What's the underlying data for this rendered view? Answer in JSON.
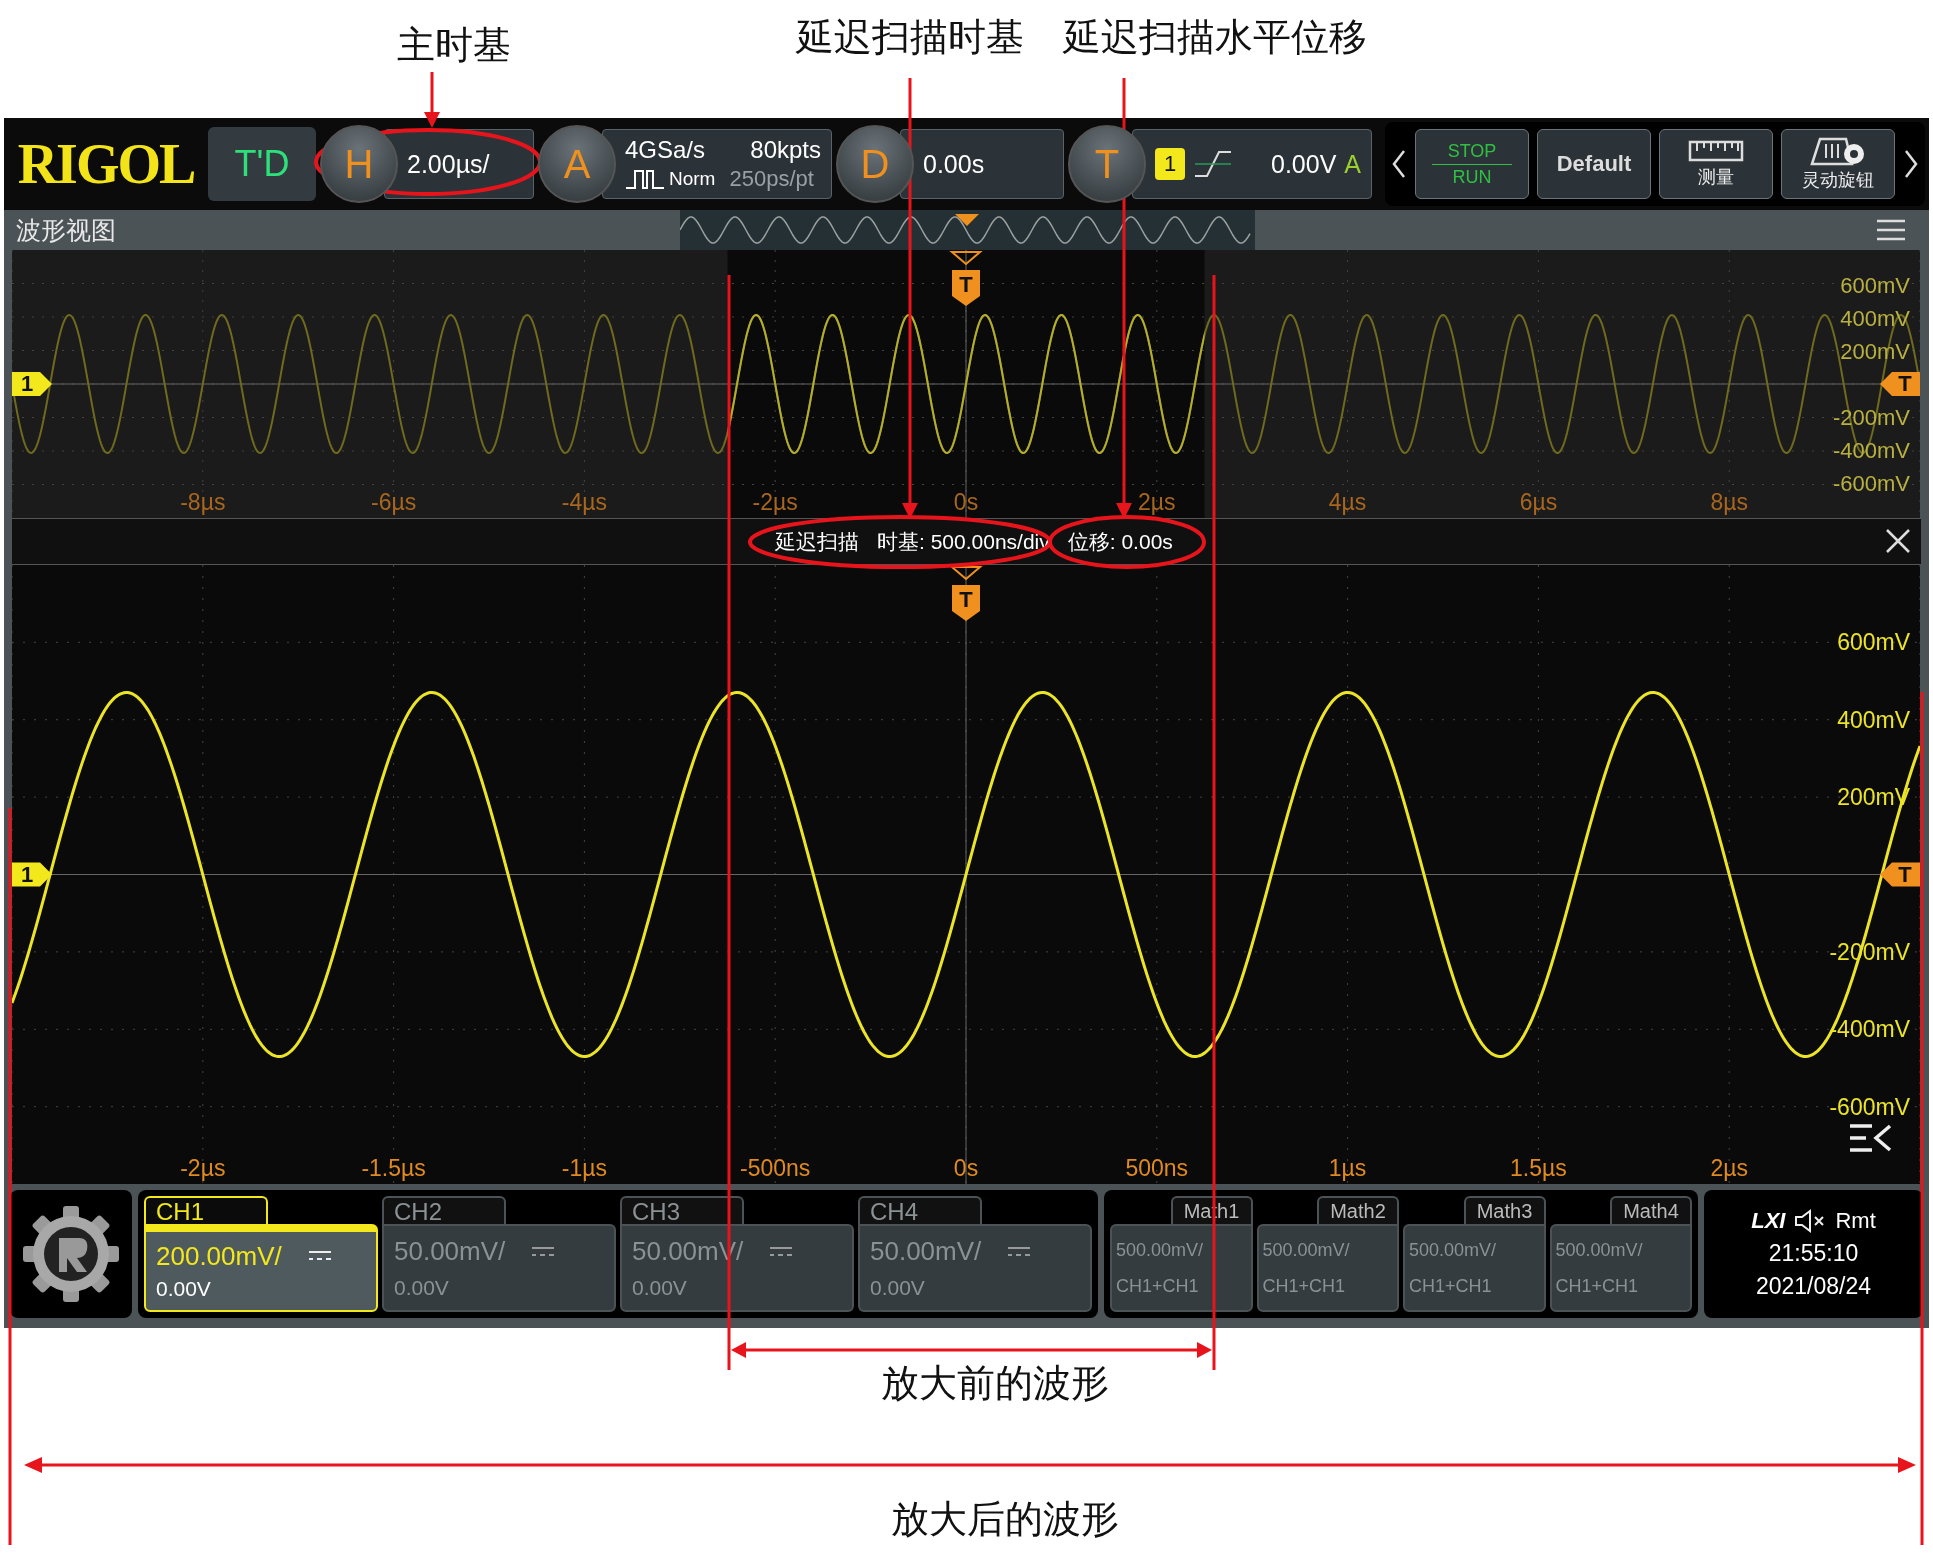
{
  "annotations": {
    "top_labels": [
      "主时基",
      "延迟扫描时基",
      "延迟扫描水平位移"
    ],
    "bottom_labels": [
      "放大前的波形",
      "放大后的波形"
    ]
  },
  "top_bar": {
    "logo": "RIGOL",
    "mode": "T'D",
    "horizontal": {
      "badge": "H",
      "scale": "2.00µs/"
    },
    "acquire": {
      "badge": "A",
      "sample_rate": "4GSa/s",
      "memory": "80kpts",
      "mode": "Norm",
      "resolution": "250ps/pt"
    },
    "delay": {
      "badge": "D",
      "value": "0.00s"
    },
    "trigger": {
      "badge": "T",
      "source": "1",
      "level": "0.00V",
      "sweep": "A"
    },
    "buttons": [
      {
        "kind": "stoprun",
        "labels": [
          "STOP",
          "RUN"
        ]
      },
      {
        "kind": "default",
        "label": "Default"
      },
      {
        "kind": "measure",
        "label": "测量"
      },
      {
        "kind": "knob",
        "label": "灵动旋钮"
      }
    ]
  },
  "view": {
    "title": "波形视图"
  },
  "overview": {
    "x_ticks": [
      "-8µs",
      "-6µs",
      "-4µs",
      "-2µs",
      "0s",
      "2µs",
      "4µs",
      "6µs",
      "8µs"
    ],
    "y_ticks": [
      "600mV",
      "400mV",
      "200mV",
      "-200mV",
      "-400mV",
      "-600mV"
    ],
    "channel_marker": "1",
    "trigger_level_marker": "T",
    "trigger_position_marker": "T"
  },
  "delay_bar": {
    "title": "延迟扫描",
    "timebase": "时基: 500.00ns/div",
    "offset": "位移: 0.00s"
  },
  "main": {
    "x_ticks": [
      "-2µs",
      "-1.5µs",
      "-1µs",
      "-500ns",
      "0s",
      "500ns",
      "1µs",
      "1.5µs",
      "2µs"
    ],
    "y_ticks": [
      "600mV",
      "400mV",
      "200mV",
      "-200mV",
      "-400mV",
      "-600mV"
    ],
    "channel_marker": "1",
    "trigger_level_marker": "T",
    "trigger_position_marker": "T"
  },
  "channels": [
    {
      "name": "CH1",
      "scale": "200.00mV/",
      "offset": "0.00V",
      "selected": true
    },
    {
      "name": "CH2",
      "scale": "50.00mV/",
      "offset": "0.00V",
      "selected": false
    },
    {
      "name": "CH3",
      "scale": "50.00mV/",
      "offset": "0.00V",
      "selected": false
    },
    {
      "name": "CH4",
      "scale": "50.00mV/",
      "offset": "0.00V",
      "selected": false
    }
  ],
  "math": [
    {
      "name": "Math1",
      "scale": "500.00mV/",
      "source": "CH1+CH1"
    },
    {
      "name": "Math2",
      "scale": "500.00mV/",
      "source": "CH1+CH1"
    },
    {
      "name": "Math3",
      "scale": "500.00mV/",
      "source": "CH1+CH1"
    },
    {
      "name": "Math4",
      "scale": "500.00mV/",
      "source": "CH1+CH1"
    }
  ],
  "status": {
    "lxi": "LXI",
    "remote": "Rmt",
    "time": "21:55:10",
    "date": "2021/08/24"
  }
}
